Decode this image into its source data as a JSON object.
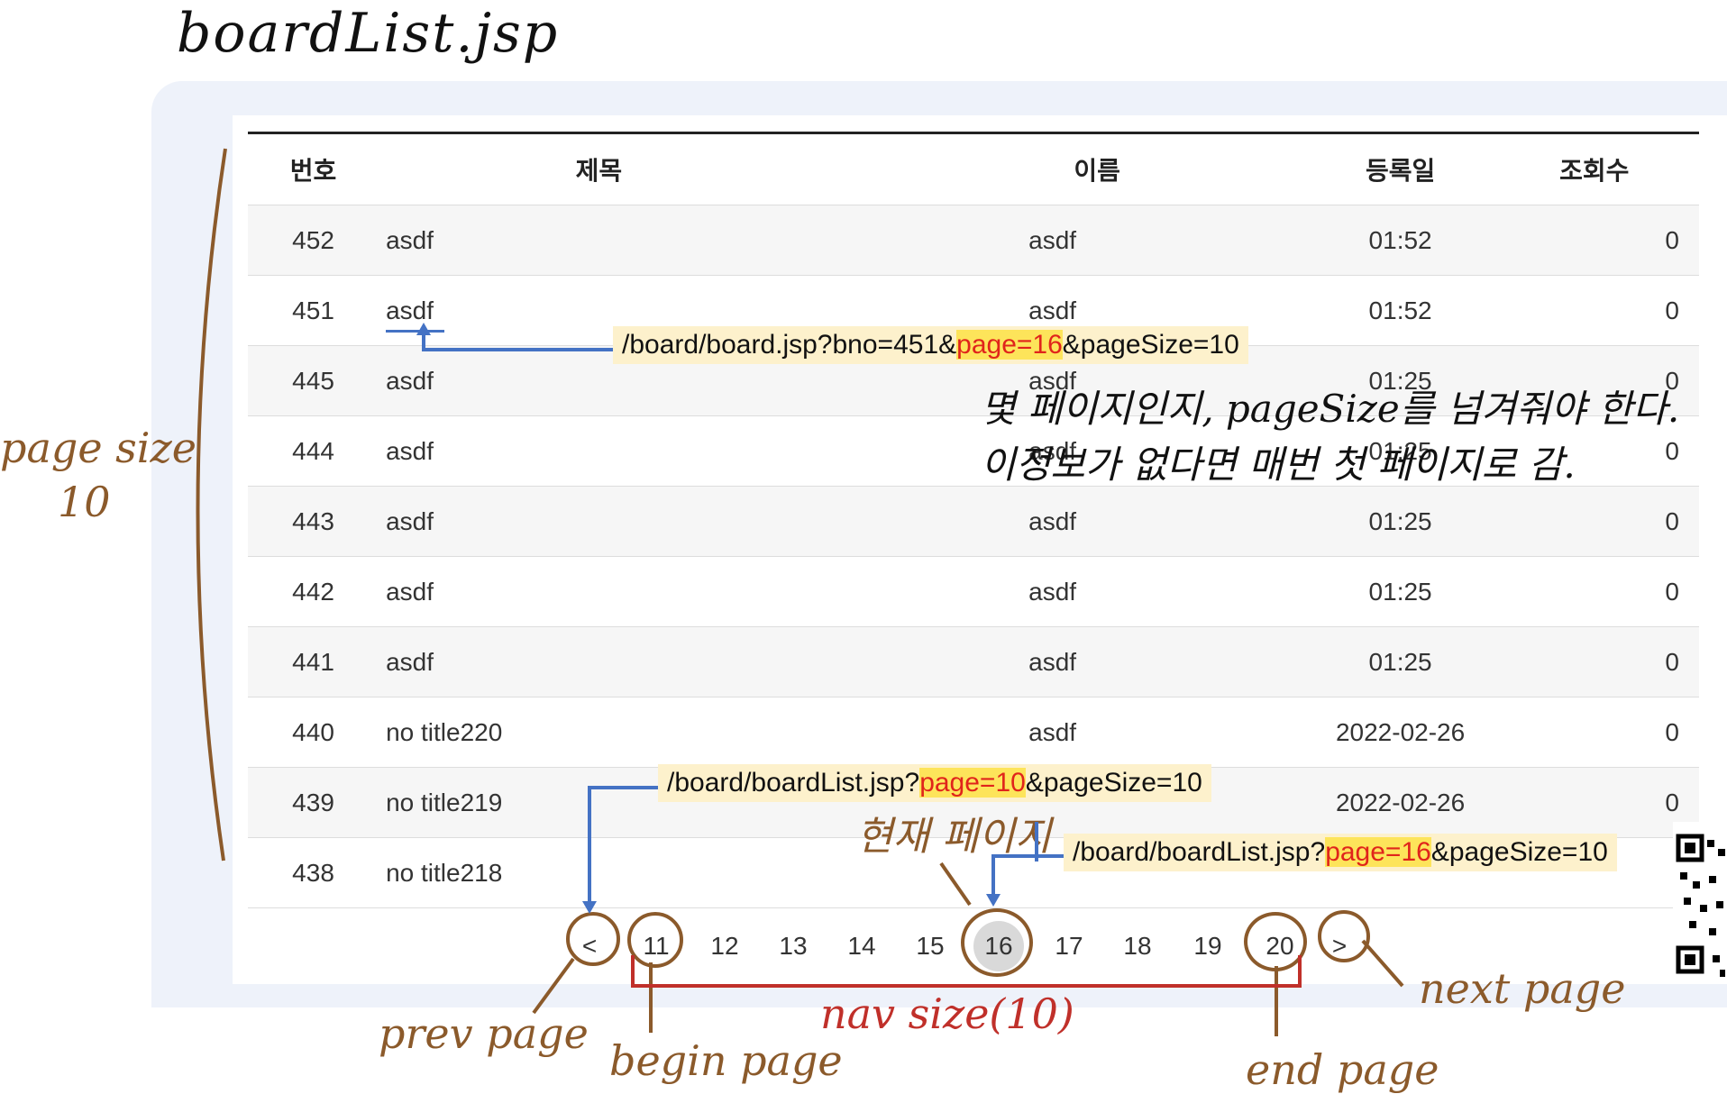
{
  "page_title": "boardList.jsp",
  "table": {
    "headers": [
      "번호",
      "제목",
      "이름",
      "등록일",
      "조회수"
    ],
    "rows": [
      [
        "452",
        "asdf",
        "asdf",
        "01:52",
        "0"
      ],
      [
        "451",
        "asdf",
        "asdf",
        "01:52",
        "0"
      ],
      [
        "445",
        "asdf",
        "asdf",
        "01:25",
        "0"
      ],
      [
        "444",
        "asdf",
        "asdf",
        "01:25",
        "0"
      ],
      [
        "443",
        "asdf",
        "asdf",
        "01:25",
        "0"
      ],
      [
        "442",
        "asdf",
        "asdf",
        "01:25",
        "0"
      ],
      [
        "441",
        "asdf",
        "asdf",
        "01:25",
        "0"
      ],
      [
        "440",
        "no title220",
        "asdf",
        "2022-02-26",
        "0"
      ],
      [
        "439",
        "no title219",
        "",
        "2022-02-26",
        "0"
      ],
      [
        "438",
        "no title218",
        "",
        "",
        ""
      ]
    ]
  },
  "pagination": {
    "prev": "<",
    "pages": [
      "11",
      "12",
      "13",
      "14",
      "15",
      "16",
      "17",
      "18",
      "19",
      "20"
    ],
    "current": "16",
    "next": ">"
  },
  "annotations": {
    "url_board": {
      "before": "/board/board.jsp?bno=451&",
      "highlight": "page=16",
      "after": "&pageSize=10"
    },
    "url_prev": {
      "before": "/board/boardList.jsp?",
      "highlight": "page=10",
      "after": "&pageSize=10"
    },
    "url_current": {
      "before": "/board/boardList.jsp?",
      "highlight": "page=16",
      "after": "&pageSize=10"
    },
    "note_line1": "몇 페이지인지, pageSize를 넘겨줘야 한다.",
    "note_line2": "이정보가 없다면 매번 첫 페이지로 감.",
    "page_size_label": "page size",
    "page_size_value": "10",
    "current_page_label": "현재 페이지",
    "prev_page_label": "prev page",
    "begin_page_label": "begin page",
    "nav_size_label": "nav size(10)",
    "end_page_label": "end page",
    "next_page_label": "next page"
  },
  "colors": {
    "annotation_brown": "#8B5A2B",
    "arrow_blue": "#4472C4",
    "bracket_red": "#C0302A",
    "highlight_yellow": "#fde45a",
    "highlight_text_red": "#e0241b",
    "url_box_bg": "#fdf1cc"
  }
}
